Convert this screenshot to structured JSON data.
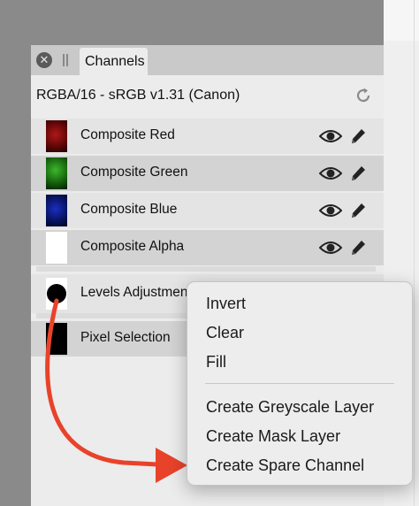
{
  "panel": {
    "tab_label": "Channels",
    "close_glyph": "✕",
    "color_profile": "RGBA/16 - sRGB v1.31 (Canon)"
  },
  "channels": [
    {
      "label": "Composite Red",
      "thumb_color": "#8a0d0d"
    },
    {
      "label": "Composite Green",
      "thumb_color": "#1c8a12"
    },
    {
      "label": "Composite Blue",
      "thumb_color": "#0b1a8a"
    },
    {
      "label": "Composite Alpha",
      "thumb_color": "#ffffff"
    }
  ],
  "layers": [
    {
      "label": "Levels Adjustment"
    },
    {
      "label": "Pixel Selection"
    }
  ],
  "context_menu": {
    "items": [
      "Invert",
      "Clear",
      "Fill"
    ],
    "create_items": [
      "Create Greyscale Layer",
      "Create Mask Layer",
      "Create Spare Channel"
    ]
  },
  "colors": {
    "annotation_arrow": "#e8432a"
  }
}
